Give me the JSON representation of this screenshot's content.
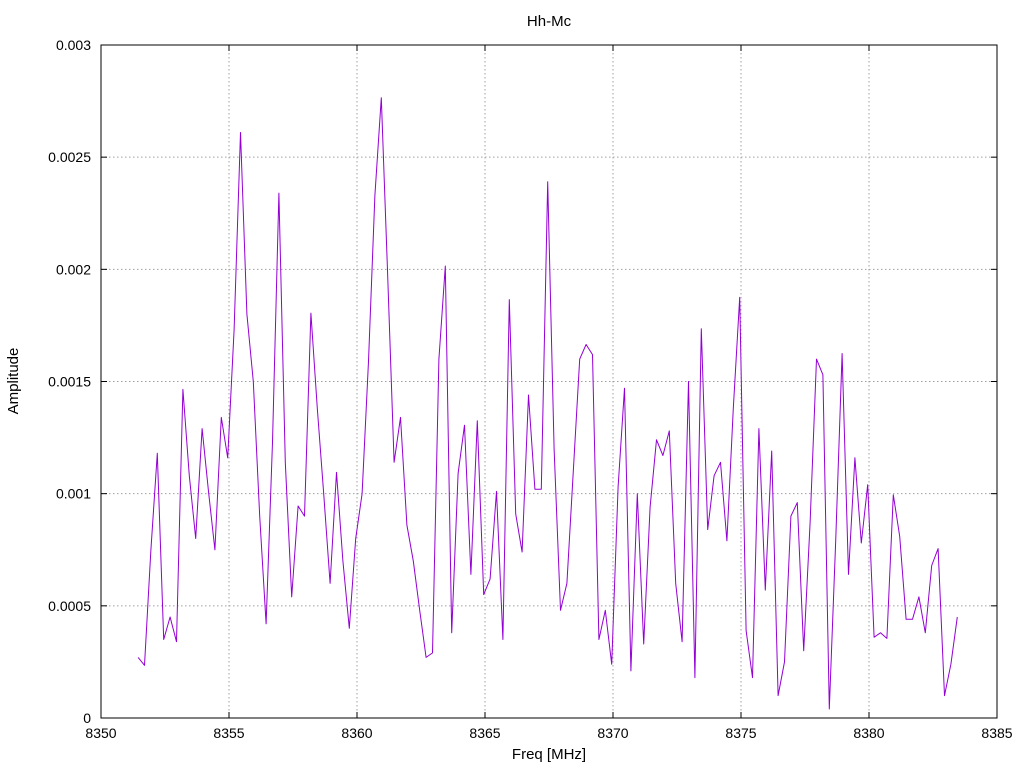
{
  "chart_data": {
    "type": "line",
    "title": "Hh-Mc",
    "xlabel": "Freq [MHz]",
    "ylabel": "Amplitude",
    "xlim": [
      8350,
      8385
    ],
    "ylim": [
      0,
      0.003
    ],
    "grid": true,
    "x_ticks": [
      8350,
      8355,
      8360,
      8365,
      8370,
      8375,
      8380,
      8385
    ],
    "x_tick_labels": [
      "8350",
      "8355",
      "8360",
      "8365",
      "8370",
      "8375",
      "8380",
      "8385"
    ],
    "y_ticks": [
      0,
      0.0005,
      0.001,
      0.0015,
      0.002,
      0.0025,
      0.003
    ],
    "y_tick_labels": [
      "0",
      "0.0005",
      "0.001",
      "0.0015",
      "0.002",
      "0.0025",
      "0.003"
    ],
    "series": [
      {
        "color": "#9400d3",
        "x": [
          8351.45,
          8351.7,
          8351.95,
          8352.2,
          8352.45,
          8352.7,
          8352.95,
          8353.2,
          8353.45,
          8353.7,
          8353.95,
          8354.2,
          8354.45,
          8354.7,
          8354.95,
          8355.2,
          8355.45,
          8355.7,
          8355.95,
          8356.2,
          8356.45,
          8356.7,
          8356.95,
          8357.2,
          8357.45,
          8357.7,
          8357.95,
          8358.2,
          8358.45,
          8358.7,
          8358.95,
          8359.2,
          8359.45,
          8359.7,
          8359.95,
          8360.2,
          8360.45,
          8360.7,
          8360.95,
          8361.2,
          8361.45,
          8361.7,
          8361.95,
          8362.2,
          8362.45,
          8362.7,
          8362.95,
          8363.2,
          8363.45,
          8363.7,
          8363.95,
          8364.2,
          8364.45,
          8364.7,
          8364.95,
          8365.2,
          8365.45,
          8365.7,
          8365.95,
          8366.2,
          8366.45,
          8366.7,
          8366.95,
          8367.2,
          8367.45,
          8367.7,
          8367.95,
          8368.2,
          8368.45,
          8368.7,
          8368.95,
          8369.2,
          8369.45,
          8369.7,
          8369.95,
          8370.2,
          8370.45,
          8370.7,
          8370.95,
          8371.2,
          8371.45,
          8371.7,
          8371.95,
          8372.2,
          8372.45,
          8372.7,
          8372.95,
          8373.2,
          8373.45,
          8373.7,
          8373.95,
          8374.2,
          8374.45,
          8374.7,
          8374.95,
          8375.2,
          8375.45,
          8375.7,
          8375.95,
          8376.2,
          8376.45,
          8376.7,
          8376.95,
          8377.2,
          8377.45,
          8377.7,
          8377.95,
          8378.2,
          8378.45,
          8378.7,
          8378.95,
          8379.2,
          8379.45,
          8379.7,
          8379.95,
          8380.2,
          8380.45,
          8380.7,
          8380.95,
          8381.2,
          8381.45,
          8381.7,
          8381.95,
          8382.2,
          8382.45,
          8382.7,
          8382.95,
          8383.2,
          8383.45
        ],
        "y": [
          0.00027,
          0.000235,
          0.00075,
          0.00118,
          0.00035,
          0.00045,
          0.00034,
          0.001465,
          0.00108,
          0.0008,
          0.00129,
          0.00101,
          0.00075,
          0.00134,
          0.00116,
          0.00173,
          0.00261,
          0.0018,
          0.0015,
          0.0009,
          0.00042,
          0.00123,
          0.00234,
          0.00114,
          0.00054,
          0.000945,
          0.0009,
          0.001805,
          0.00138,
          0.001,
          0.0006,
          0.001095,
          0.0007,
          0.0004,
          0.0008,
          0.001,
          0.00159,
          0.00233,
          0.002765,
          0.00197,
          0.00114,
          0.00134,
          0.00086,
          0.0007,
          0.00048,
          0.00027,
          0.00029,
          0.0016,
          0.002015,
          0.00038,
          0.00109,
          0.001305,
          0.00064,
          0.001325,
          0.00055,
          0.00062,
          0.00101,
          0.00035,
          0.001865,
          0.00091,
          0.00074,
          0.00144,
          0.00102,
          0.00102,
          0.00239,
          0.0012,
          0.00048,
          0.0006,
          0.0011,
          0.0016,
          0.001665,
          0.00162,
          0.00035,
          0.00048,
          0.00024,
          0.00103,
          0.00147,
          0.00021,
          0.001,
          0.00033,
          0.00094,
          0.00124,
          0.00117,
          0.00128,
          0.0006,
          0.00034,
          0.0015,
          0.00018,
          0.001735,
          0.00084,
          0.00108,
          0.00114,
          0.00079,
          0.00138,
          0.001875,
          0.00039,
          0.00018,
          0.00129,
          0.00057,
          0.00119,
          0.0001,
          0.00025,
          0.0009,
          0.00096,
          0.0003,
          0.00087,
          0.0016,
          0.00153,
          4e-05,
          0.00079,
          0.001625,
          0.00064,
          0.00116,
          0.00078,
          0.00104,
          0.00036,
          0.00038,
          0.000355,
          0.000995,
          0.00081,
          0.00044,
          0.00044,
          0.00054,
          0.00038,
          0.00068,
          0.000755,
          0.0001,
          0.00024,
          0.00045
        ]
      }
    ]
  }
}
